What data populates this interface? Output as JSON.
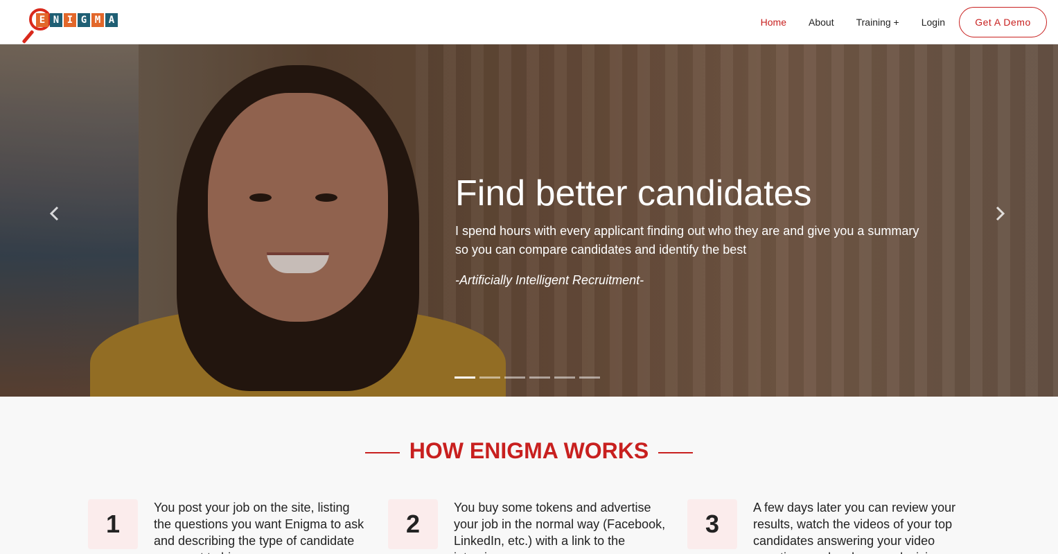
{
  "brand": {
    "logo_letters": [
      "E",
      "N",
      "I",
      "G",
      "M",
      "A"
    ]
  },
  "nav": {
    "items": [
      {
        "label": "Home",
        "active": true
      },
      {
        "label": "About",
        "active": false
      },
      {
        "label": "Training +",
        "active": false
      },
      {
        "label": "Login",
        "active": false
      }
    ],
    "cta_label": "Get A Demo"
  },
  "hero": {
    "title": "Find better candidates",
    "description": "I spend hours with every applicant finding out who they are and give you a summary so you can compare candidates and identify the best",
    "quote": "-Artificially Intelligent Recruitment-",
    "slide_count": 6,
    "active_slide": 1,
    "prev_icon": "chevron-left-icon",
    "next_icon": "chevron-right-icon"
  },
  "how": {
    "title": "HOW ENIGMA WORKS",
    "steps": [
      {
        "number": "1",
        "text": "You post your job on the site, listing the questions you want Enigma to ask and describing the type of candidate you want to hire."
      },
      {
        "number": "2",
        "text": "You buy some tokens and advertise your job in the normal way (Facebook, LinkedIn, etc.) with a link to the interview page."
      },
      {
        "number": "3",
        "text": "A few days later you can review your results, watch the videos of your top candidates answering your video questions and make your decision."
      }
    ]
  },
  "colors": {
    "accent": "#c8201f",
    "logo_orange": "#e2672a",
    "logo_teal": "#1f5f74"
  }
}
